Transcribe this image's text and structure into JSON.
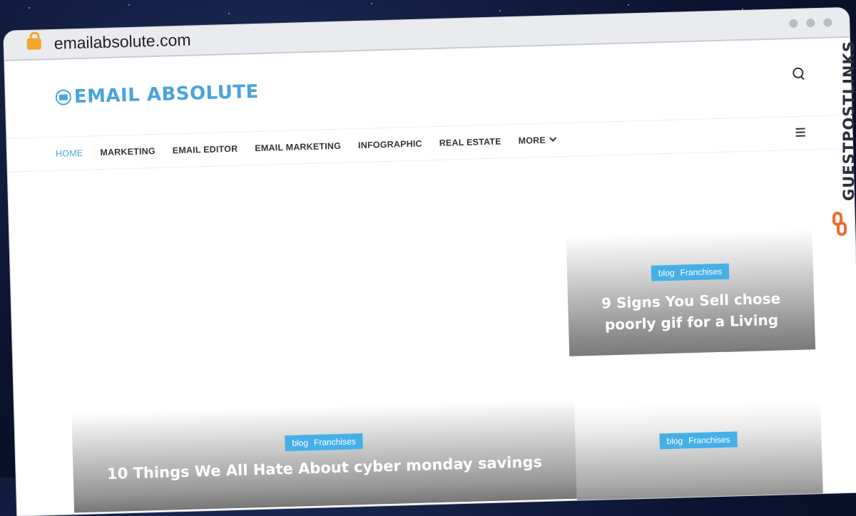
{
  "browser": {
    "url": "emailabsolute.com",
    "icons": [
      "lock-icon",
      "window-dot-icon"
    ]
  },
  "site": {
    "logo_text": "EMAIL ABSOLUTE",
    "nav": {
      "items": [
        {
          "label": "HOME"
        },
        {
          "label": "MARKETING"
        },
        {
          "label": "EMAIL EDITOR"
        },
        {
          "label": "EMAIL MARKETING"
        },
        {
          "label": "INFOGRAPHIC"
        },
        {
          "label": "REAL ESTATE"
        },
        {
          "label": "MORE"
        }
      ],
      "active_index": 0
    },
    "icons": [
      "search-icon",
      "hamburger-menu-icon",
      "chevron-down-icon",
      "envelope-icon"
    ]
  },
  "posts": [
    {
      "tag1": "blog",
      "tag2": "Franchises",
      "title": "9 Signs You Sell chose poorly gif for a Living"
    },
    {
      "tag1": "blog",
      "tag2": "Franchises",
      "title": "10 Things We All Hate About cyber monday savings"
    },
    {
      "tag1": "blog",
      "tag2": "Franchises",
      "title": ""
    }
  ],
  "watermark": {
    "text": "GUESTPOSTLINKS",
    "accent_color": "#f26a2e"
  },
  "colors": {
    "brand": "#4aa3dc",
    "tag_bg": "#45b0e8"
  }
}
